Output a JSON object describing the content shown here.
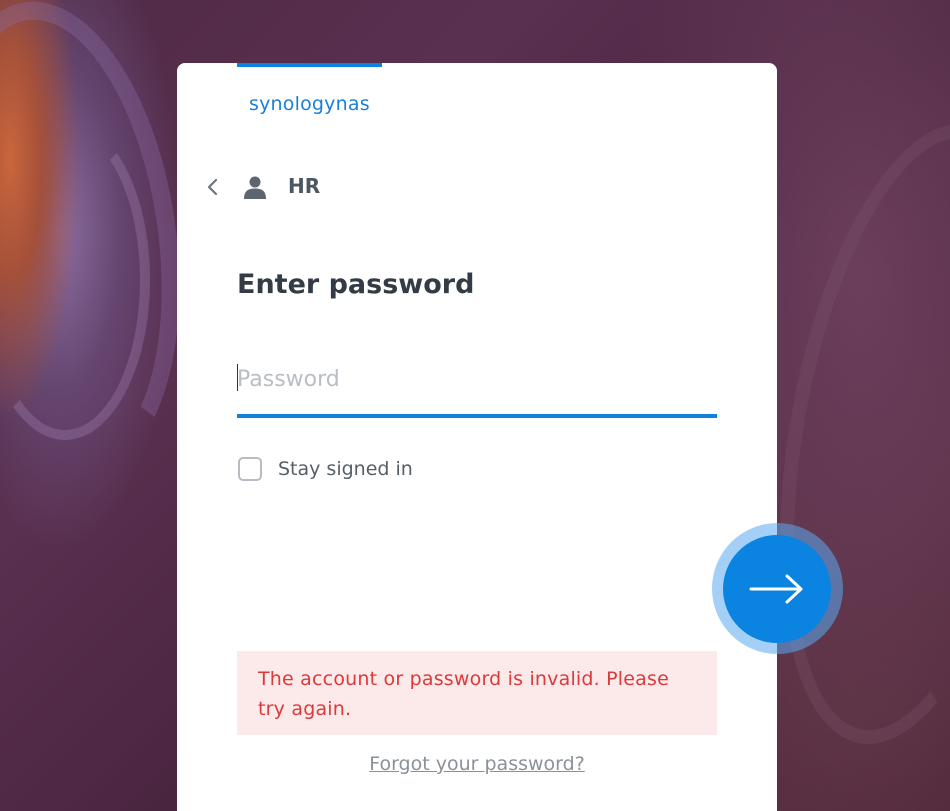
{
  "login": {
    "host_name": "synologynas",
    "user_name": "HR",
    "title": "Enter password",
    "password": {
      "value": "",
      "placeholder": "Password"
    },
    "stay_signed_in": {
      "label": "Stay signed in",
      "checked": false
    },
    "error_message": "The account or password is invalid. Please try again.",
    "forgot_link": "Forgot your password?"
  },
  "icons": {
    "back": "chevron-left-icon",
    "user": "user-icon",
    "next": "arrow-right-icon"
  },
  "colors": {
    "accent": "#0a84e0",
    "error_text": "#db3a3a",
    "error_bg": "#fce9ea",
    "title": "#333c46"
  }
}
